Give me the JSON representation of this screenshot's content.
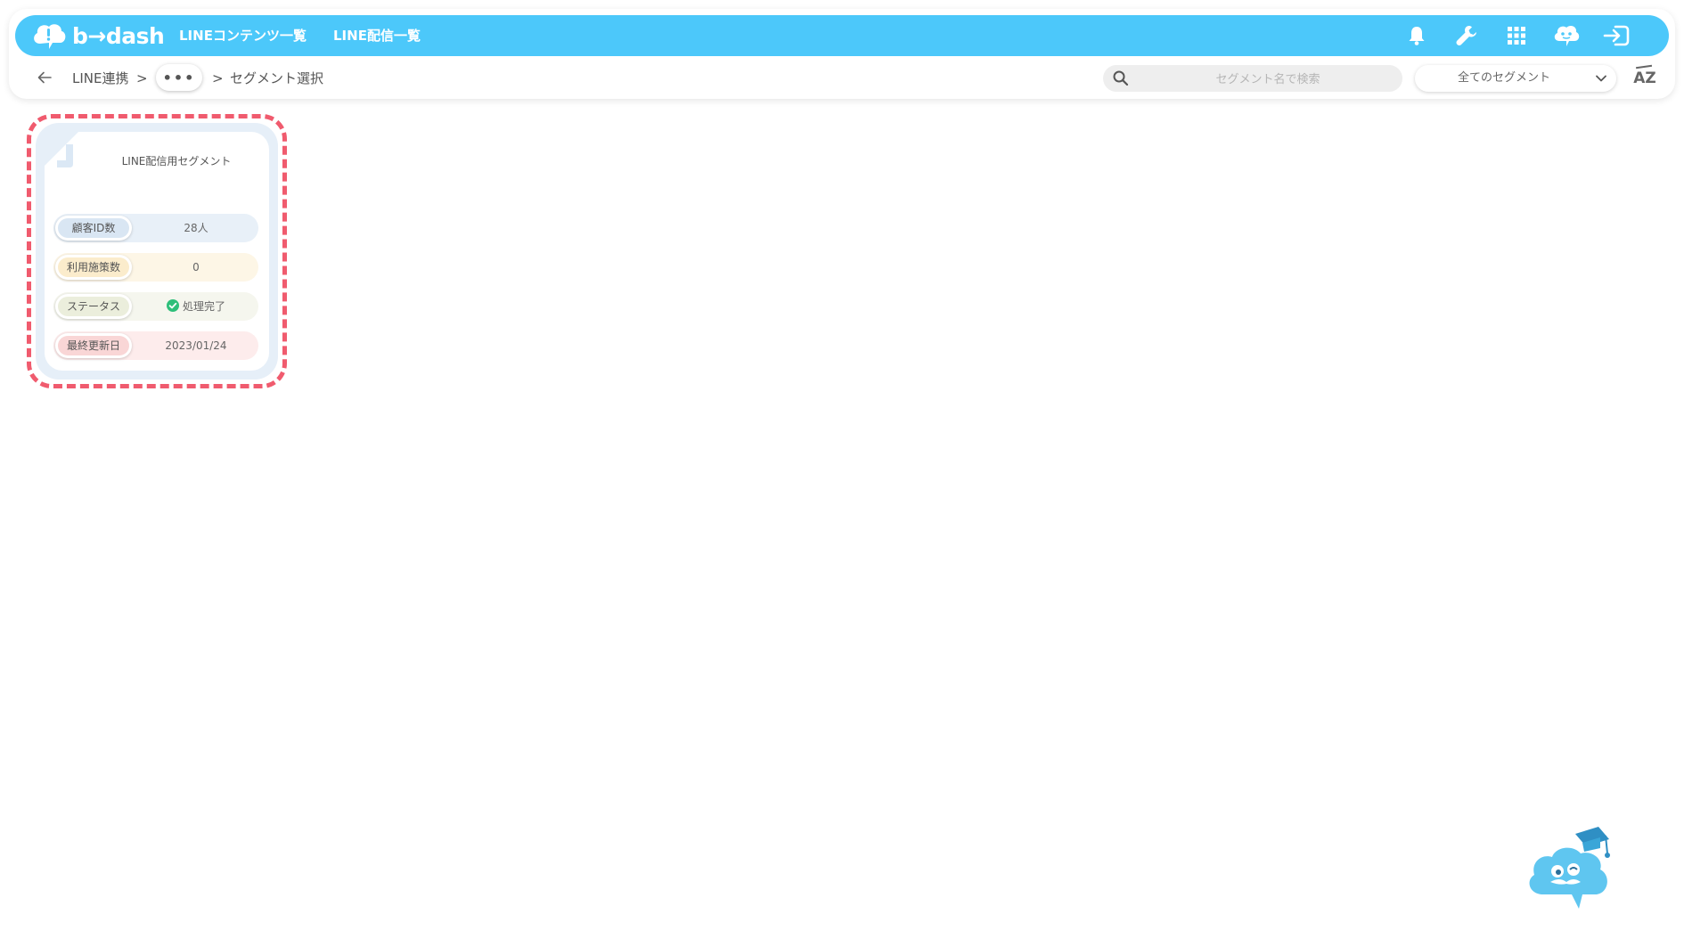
{
  "app": {
    "logo_text": "b→dash",
    "colors": {
      "primary": "#4cc8fa",
      "highlight": "#f05b6e",
      "success": "#2ebf7a"
    }
  },
  "topbar": {
    "nav": [
      "LINEコンテンツ一覧",
      "LINE配信一覧"
    ],
    "icons": [
      "bell-icon",
      "wrench-icon",
      "grid-icon",
      "help-chat-icon",
      "logout-icon"
    ]
  },
  "breadcrumb": {
    "first": "LINE連携",
    "separator": ">",
    "more": "•••",
    "current": "セグメント選択"
  },
  "search": {
    "placeholder": "セグメント名で検索"
  },
  "filter": {
    "selected": "全てのセグメント"
  },
  "sort": {
    "label": "AZ"
  },
  "segment_card": {
    "title": "LINE配信用セグメント",
    "rows": [
      {
        "label": "顧客ID数",
        "value": "28人"
      },
      {
        "label": "利用施策数",
        "value": "0"
      },
      {
        "label": "ステータス",
        "value": "処理完了"
      },
      {
        "label": "最終更新日",
        "value": "2023/01/24"
      }
    ]
  }
}
